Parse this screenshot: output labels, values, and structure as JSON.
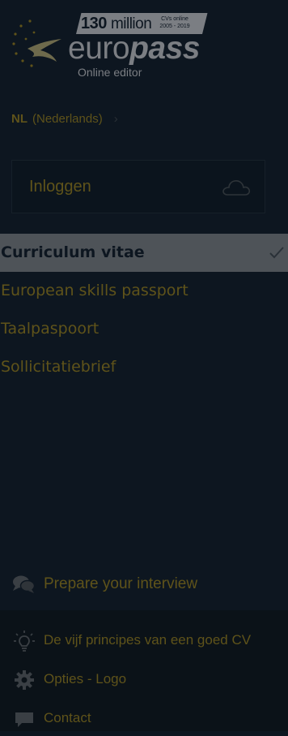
{
  "logo": {
    "count_number": "130",
    "count_word": "million",
    "cvs_line": "CVs online",
    "years_line": "2005 - 2019",
    "word_regular": "euro",
    "word_bold": "pass",
    "subtitle": "Online editor",
    "icon": "stars-figure-icon"
  },
  "language": {
    "code": "NL",
    "name": "(Nederlands)",
    "chevron": "›"
  },
  "login": {
    "label": "Inloggen",
    "icon": "cloud-icon"
  },
  "nav": {
    "items": [
      {
        "label": "Curriculum vitae",
        "active": true,
        "icon": "check-icon"
      },
      {
        "label": "European skills passport",
        "active": false
      },
      {
        "label": "Taalpaspoort",
        "active": false
      },
      {
        "label": "Sollicitatiebrief",
        "active": false
      }
    ]
  },
  "interview": {
    "label": "Prepare your interview",
    "icon": "chat-bubbles-icon"
  },
  "footer": {
    "items": [
      {
        "label": "De vijf principes van een goed CV",
        "icon": "lightbulb-icon"
      },
      {
        "label": "Opties - Logo",
        "icon": "gear-icon"
      },
      {
        "label": "Contact",
        "icon": "speech-bubble-icon"
      }
    ]
  },
  "colors": {
    "background": "#0d1620",
    "accent_text": "#5f531a",
    "logo_grey": "#7b7e83",
    "active_row": "#4e5358",
    "footer_background": "#0b1218"
  }
}
